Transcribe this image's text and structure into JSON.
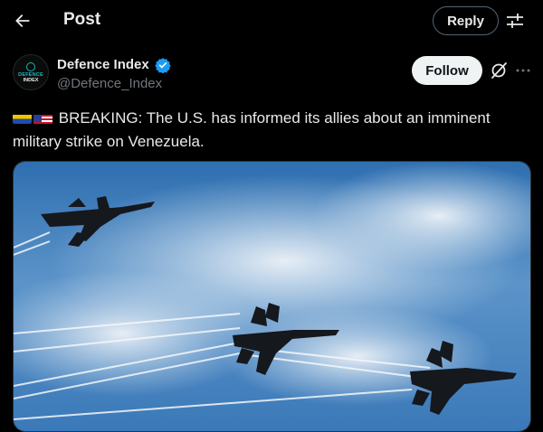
{
  "header": {
    "title": "Post",
    "reply_label": "Reply",
    "back_icon": "arrow-left-icon",
    "settings_icon": "sliders-icon"
  },
  "author": {
    "name": "Defence Index",
    "handle": "@Defence_Index",
    "avatar_text_line1": "DEFENCE",
    "avatar_text_line2": "INDEX",
    "verified": true,
    "verified_color": "#1d9bf0"
  },
  "actions": {
    "follow_label": "Follow",
    "grok_icon": "grok-icon",
    "more_icon": "more-icon"
  },
  "post": {
    "flags": [
      "venezuela-flag",
      "us-flag"
    ],
    "text": "BREAKING: The U.S. has informed its allies about an imminent military strike on Venezuela."
  },
  "media": {
    "description_icon": "image",
    "jets": 3
  },
  "colors": {
    "background": "#000000",
    "text_primary": "#e7e9ea",
    "text_secondary": "#71767b",
    "border": "#536471",
    "follow_bg": "#eff3f4"
  }
}
